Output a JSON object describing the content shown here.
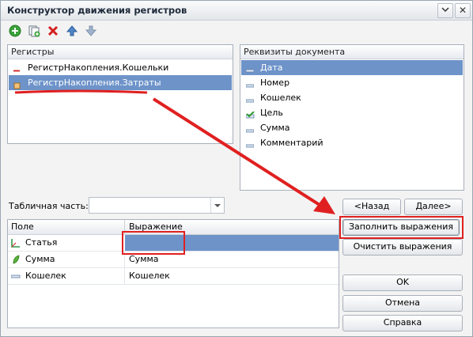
{
  "window": {
    "title": "Конструктор движения регистров",
    "close_glyph": "✕"
  },
  "toolbar": {
    "icons": [
      "add-icon",
      "copy-icon",
      "delete-icon",
      "move-up-icon",
      "move-down-icon"
    ]
  },
  "registers": {
    "header": "Регистры",
    "items": [
      {
        "label": "РегистрНакопления.Кошельки",
        "icon": "dash-red-icon",
        "selected": false
      },
      {
        "label": "РегистрНакопления.Затраты",
        "icon": "register-icon",
        "selected": true
      }
    ]
  },
  "requisites": {
    "header": "Реквизиты документа",
    "items": [
      {
        "label": "Дата",
        "selected": true
      },
      {
        "label": "Номер",
        "selected": false
      },
      {
        "label": "Кошелек",
        "selected": false
      },
      {
        "label": "Цель",
        "selected": false
      },
      {
        "label": "Сумма",
        "selected": false
      },
      {
        "label": "Комментарий",
        "selected": false
      }
    ]
  },
  "tabular": {
    "label": "Табличная часть:",
    "value": ""
  },
  "fields_table": {
    "columns": [
      "Поле",
      "Выражение"
    ],
    "rows": [
      {
        "field": "Статья",
        "expression": "",
        "icon": "axis-icon",
        "selected": true
      },
      {
        "field": "Сумма",
        "expression": "Сумма",
        "icon": "leaf-icon",
        "selected": false
      },
      {
        "field": "Кошелек",
        "expression": "Кошелек",
        "icon": "dash-icon",
        "selected": false
      }
    ]
  },
  "buttons": {
    "back": "<Назад",
    "next": "Далее>",
    "fill": "Заполнить выражения",
    "clear": "Очистить выражения",
    "ok": "OK",
    "cancel": "Отмена",
    "help": "Справка"
  },
  "colors": {
    "selection": "#6d93c9",
    "annotation": "#e02020"
  }
}
